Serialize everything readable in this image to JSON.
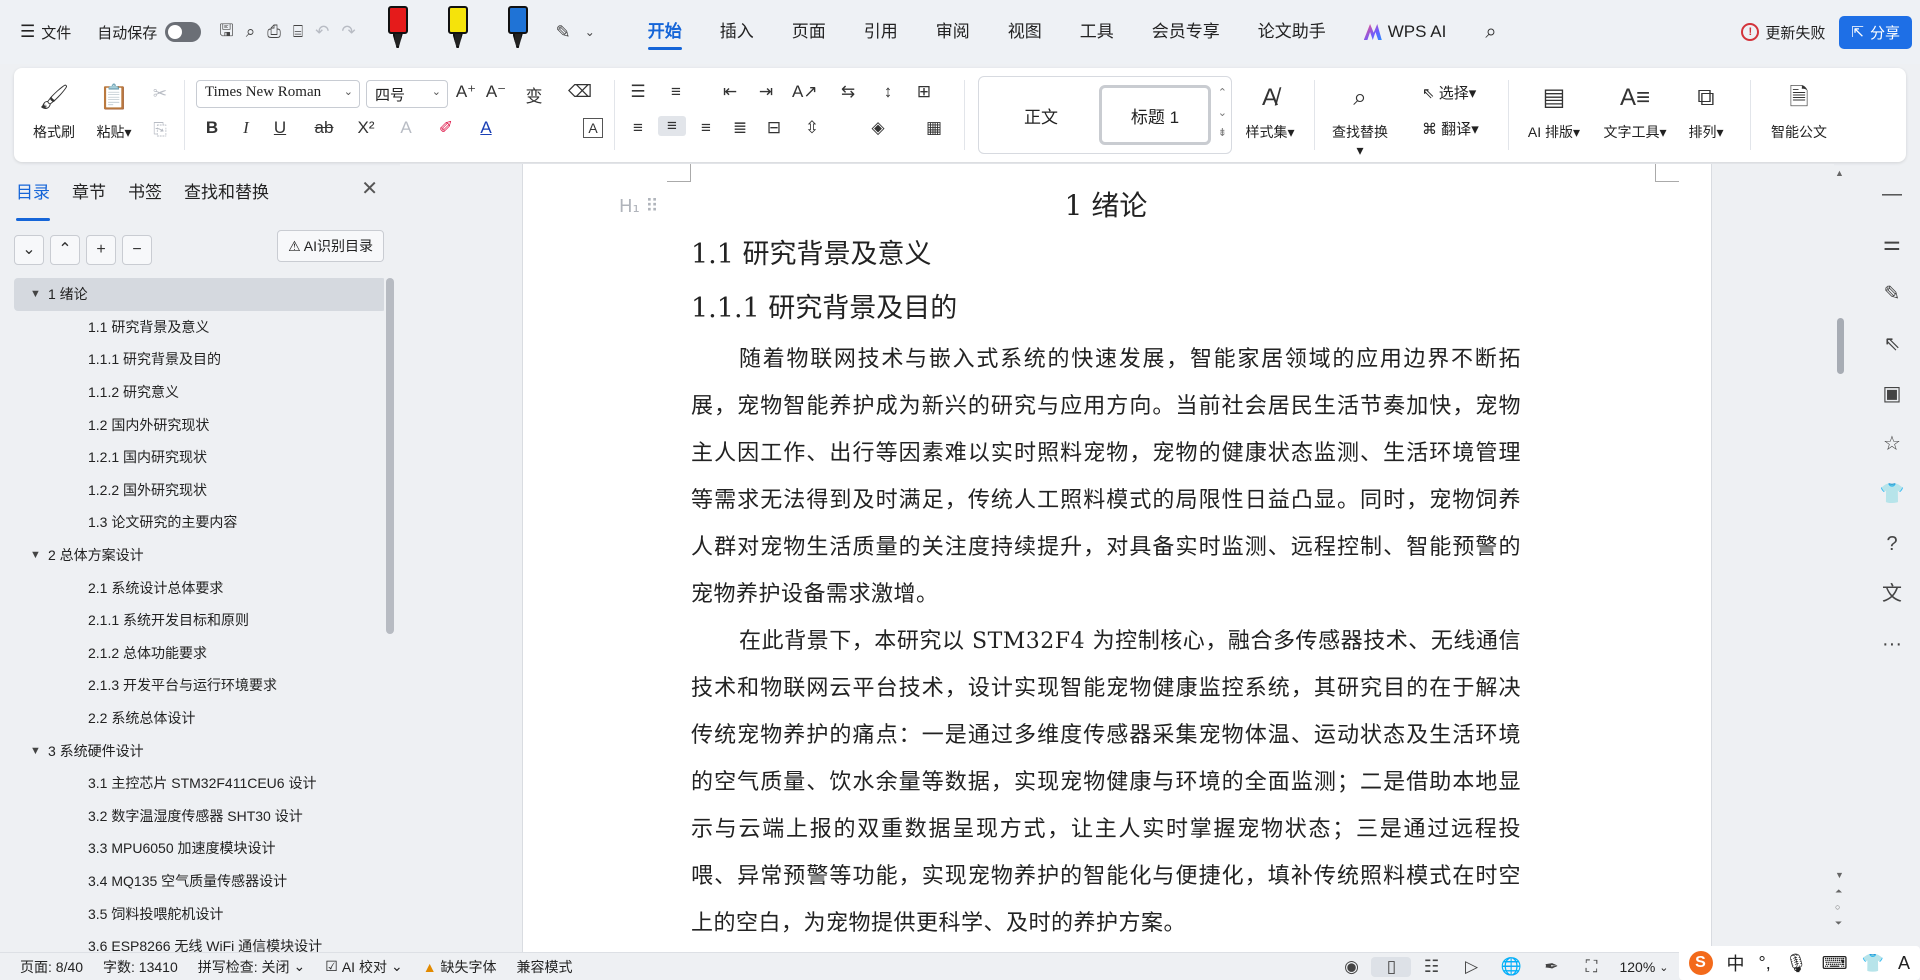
{
  "topbar": {
    "file_label": "文件",
    "autosave_label": "自动保存",
    "tabs": [
      "开始",
      "插入",
      "页面",
      "引用",
      "审阅",
      "视图",
      "工具",
      "会员专享",
      "论文助手"
    ],
    "active_tab": "开始",
    "wps_ai_label": "WPS AI",
    "update_failed_label": "更新失败",
    "share_label": "分享",
    "marker_colors": [
      "#e51b1b",
      "#f5e30b",
      "#1f73d6"
    ]
  },
  "ribbon": {
    "format_painter": "格式刷",
    "paste": "粘贴",
    "font_name": "Times New Roman",
    "font_size": "四号",
    "style_normal": "正文",
    "style_heading": "标题 1",
    "styles_set": "样式集",
    "find_replace": "查找替换",
    "select": "选择",
    "translate": "翻译",
    "ai_layout": "AI 排版",
    "text_tools": "文字工具",
    "arrange": "排列",
    "smart_doc": "智能公文"
  },
  "leftpanel": {
    "tabs": [
      "目录",
      "章节",
      "书签",
      "查找和替换"
    ],
    "ai_toc_label": "AI识别目录",
    "toc": [
      {
        "level": 1,
        "text": "1  绪论",
        "selected": true
      },
      {
        "level": 2,
        "text": "1.1  研究背景及意义"
      },
      {
        "level": 3,
        "text": "1.1.1  研究背景及目的"
      },
      {
        "level": 3,
        "text": "1.1.2  研究意义"
      },
      {
        "level": 2,
        "text": "1.2  国内外研究现状"
      },
      {
        "level": 3,
        "text": "1.2.1  国内研究现状"
      },
      {
        "level": 3,
        "text": "1.2.2  国外研究现状"
      },
      {
        "level": 2,
        "text": "1.3  论文研究的主要内容"
      },
      {
        "level": 1,
        "text": "2  总体方案设计"
      },
      {
        "level": 2,
        "text": "2.1  系统设计总体要求"
      },
      {
        "level": 3,
        "text": "2.1.1  系统开发目标和原则"
      },
      {
        "level": 3,
        "text": "2.1.2  总体功能要求"
      },
      {
        "level": 3,
        "text": "2.1.3  开发平台与运行环境要求"
      },
      {
        "level": 2,
        "text": "2.2  系统总体设计"
      },
      {
        "level": 1,
        "text": "3  系统硬件设计"
      },
      {
        "level": 2,
        "text": "3.1  主控芯片 STM32F411CEU6 设计"
      },
      {
        "level": 2,
        "text": "3.2  数字温湿度传感器 SHT30 设计"
      },
      {
        "level": 2,
        "text": "3.3 MPU6050 加速度模块设计"
      },
      {
        "level": 2,
        "text": "3.4 MQ135 空气质量传感器设计"
      },
      {
        "level": 2,
        "text": "3.5  饲料投喂舵机设计"
      },
      {
        "level": 2,
        "text": "3.6 ESP8266  无线 WiFi 通信模块设计"
      }
    ]
  },
  "document": {
    "h1": "1  绪论",
    "h2": "1.1  研究背景及意义",
    "h3": "1.1.1  研究背景及目的",
    "para1": "随着物联网技术与嵌入式系统的快速发展，智能家居领域的应用边界不断拓展，宠物智能养护成为新兴的研究与应用方向。当前社会居民生活节奏加快，宠物主人因工作、出行等因素难以实时照料宠物，宠物的健康状态监测、生活环境管理等需求无法得到及时满足，传统人工照料模式的局限性日益凸显。同时，宠物饲养人群对宠物生活质量的关注度持续提升，对具备实时监测、远程控制、智能预警的宠物养护设备需求激增。",
    "para2": "在此背景下，本研究以 STM32F4 为控制核心，融合多传感器技术、无线通信技术和物联网云平台技术，设计实现智能宠物健康监控系统，其研究目的在于解决传统宠物养护的痛点：一是通过多维度传感器采集宠物体温、运动状态及生活环境的空气质量、饮水余量等数据，实现宠物健康与环境的全面监测；二是借助本地显示与云端上报的双重数据呈现方式，让主人实时掌握宠物状态；三是通过远程投喂、异常预警等功能，实现宠物养护的智能化与便捷化，填补传统照料模式在时空上的空白，为宠物提供更科学、及时的养护方案。"
  },
  "statusbar": {
    "page": "页面: 8/40",
    "words": "字数: 13410",
    "spellcheck": "拼写检查: 关闭",
    "ai_proofread": "AI 校对",
    "missing_fonts": "缺失字体",
    "compat_mode": "兼容模式",
    "zoom": "120%"
  },
  "ime": {
    "lang": "中"
  }
}
